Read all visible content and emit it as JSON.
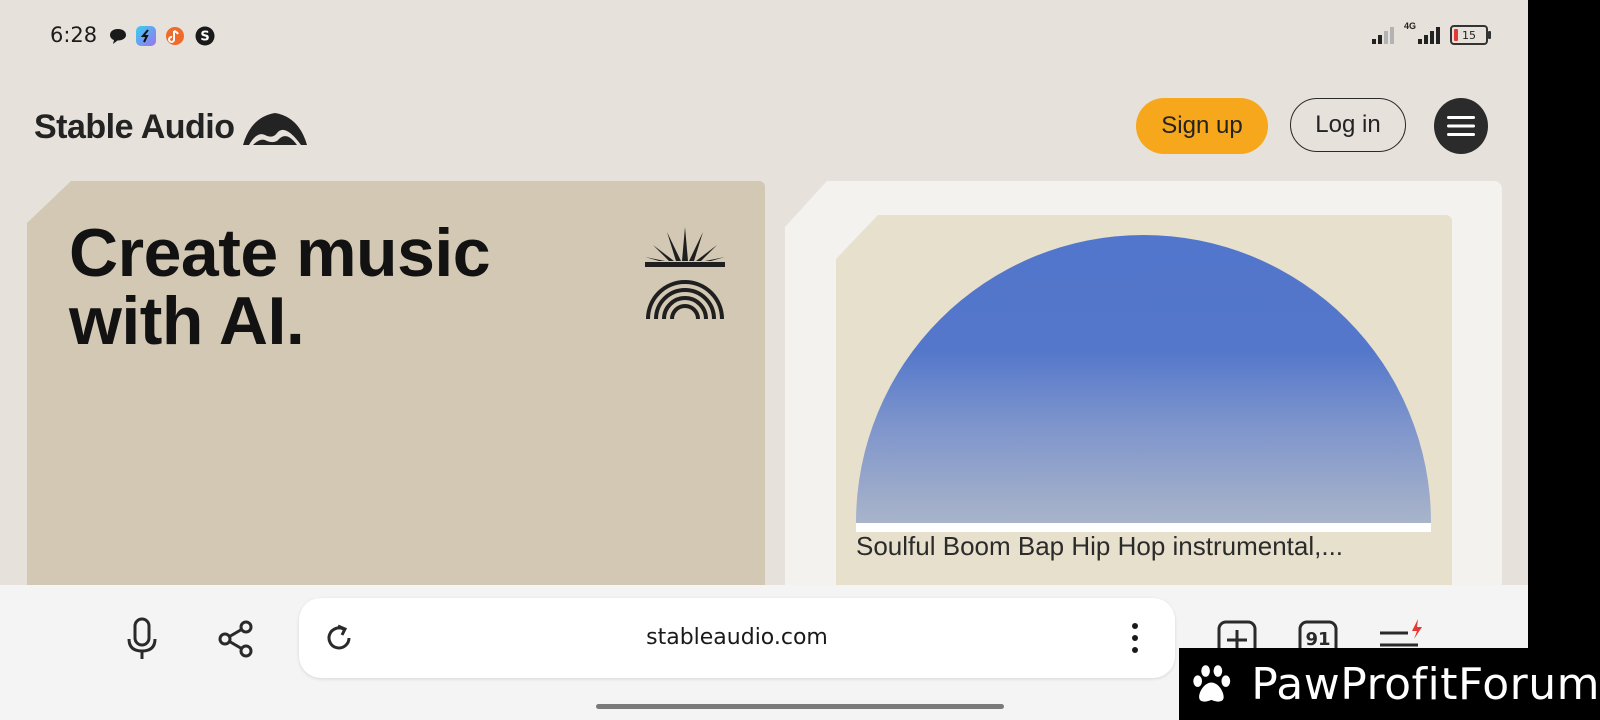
{
  "status_bar": {
    "time": "6:28",
    "network_label": "4G",
    "battery_level": "15",
    "notification_icons": [
      "chat-bubble-icon",
      "shazam-app-icon",
      "music-app-icon",
      "threads-icon"
    ]
  },
  "header": {
    "logo_text": "Stable Audio",
    "signup_label": "Sign up",
    "login_label": "Log in",
    "menu_icon": "hamburger-menu-icon"
  },
  "hero": {
    "title": "Create music with AI."
  },
  "player": {
    "track_title": "Soulful Boom Bap Hip Hop instrumental,..."
  },
  "browser": {
    "url": "stableaudio.com",
    "tab_count": "91",
    "icons": [
      "microphone-icon",
      "share-icon",
      "reload-icon",
      "more-vert-icon",
      "new-tab-icon",
      "tabs-icon",
      "menu-icon"
    ]
  },
  "watermark": {
    "text": "PawProfitForum"
  },
  "colors": {
    "page_bg": "#e6e1da",
    "accent": "#f6a71c",
    "hero_card": "#d3c8b3",
    "dome_top": "#5276cb",
    "dome_bottom": "#a9b4ca"
  }
}
